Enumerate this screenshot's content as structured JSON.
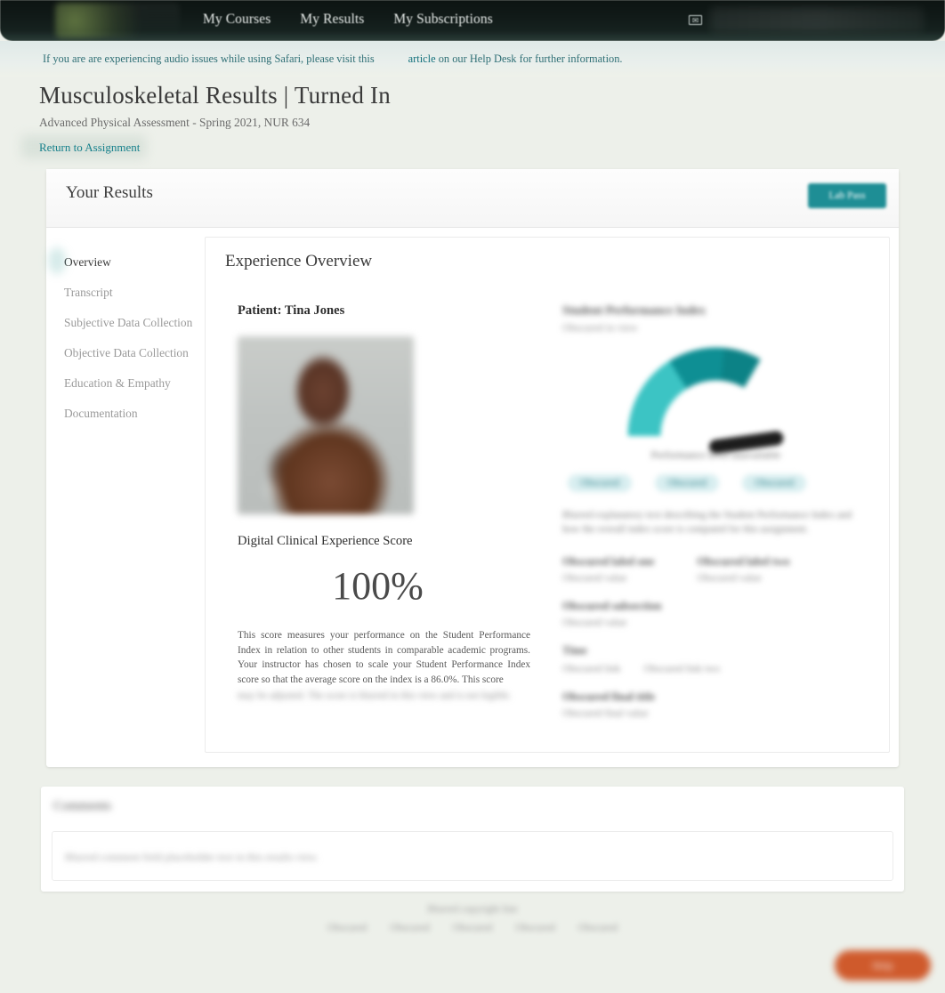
{
  "topnav": {
    "logo_alt": "shadow-health-logo",
    "links": [
      {
        "label": "My Courses"
      },
      {
        "label": "My Results"
      },
      {
        "label": "My Subscriptions"
      }
    ],
    "mail_icon": "envelope-icon",
    "mail_glyph": "✉"
  },
  "notice": {
    "text_before": "If you are are experiencing audio issues while using Safari, please visit this",
    "link_label": "article",
    "text_after": "on our Help Desk for further information."
  },
  "page": {
    "title": "Musculoskeletal Results | Turned In",
    "subtitle": "Advanced Physical Assessment - Spring 2021, NUR 634",
    "return_link": "Return to Assignment"
  },
  "results": {
    "header_title": "Your Results",
    "lab_pass_label": "Lab Pass"
  },
  "sidebar": {
    "items": [
      {
        "label": "Overview",
        "active": true
      },
      {
        "label": "Transcript",
        "active": false
      },
      {
        "label": "Subjective Data Collection",
        "active": false
      },
      {
        "label": "Objective Data Collection",
        "active": false
      },
      {
        "label": "Education & Empathy",
        "active": false
      },
      {
        "label": "Documentation",
        "active": false
      }
    ]
  },
  "overview": {
    "panel_title": "Experience Overview",
    "patient_label": "Patient: Tina Jones",
    "patient_photo_alt": "patient-avatar",
    "score_label": "Digital Clinical Experience Score",
    "score_value": "100%",
    "score_description": "This score measures your performance on the Student Performance Index in relation to other students in comparable academic programs. Your instructor has chosen to scale your Student Performance Index score so that the average score on the index is a 86.0%. This score",
    "score_description_obscured": "may be adjusted. The score is blurred in this view and is not legible."
  },
  "spi": {
    "title": "Student Performance Index",
    "subtitle": "Obscured in view",
    "gauge_caption": "Performance level unavailable",
    "pills": [
      {
        "label": "Obscured"
      },
      {
        "label": "Obscured"
      },
      {
        "label": "Obscured"
      }
    ],
    "blurb": "Blurred explanatory text describing the Student Performance Index and how the overall index score is computed for this assignment.",
    "stats": [
      {
        "title": "Obscured label one",
        "value": "Obscured value"
      },
      {
        "title": "Obscured label two",
        "value": "Obscured value"
      }
    ],
    "subsection_title": "Obscured subsection",
    "subsection_value": "Obscured value",
    "time_title": "Time",
    "time_links": [
      {
        "label": "Obscured link"
      },
      {
        "label": "Obscured link two"
      }
    ],
    "final_title": "Obscured final title",
    "final_value": "Obscured final value"
  },
  "comments": {
    "title": "Comments",
    "placeholder": "Blurred comment field placeholder text in this results view."
  },
  "footer": {
    "copyright": "Blurred copyright line",
    "links": [
      {
        "label": "Obscured"
      },
      {
        "label": "Obscured"
      },
      {
        "label": "Obscured"
      },
      {
        "label": "Obscured"
      },
      {
        "label": "Obscured"
      }
    ]
  },
  "chat": {
    "label": "Help"
  },
  "colors": {
    "brand_teal": "#1e8e95",
    "link_teal": "#17808c",
    "nav_dark": "#111a18",
    "page_bg": "#edf0ea",
    "chat_orange": "#cf5a2c",
    "gauge_light": "#3cc4c4",
    "gauge_dark": "#0e8f94"
  }
}
